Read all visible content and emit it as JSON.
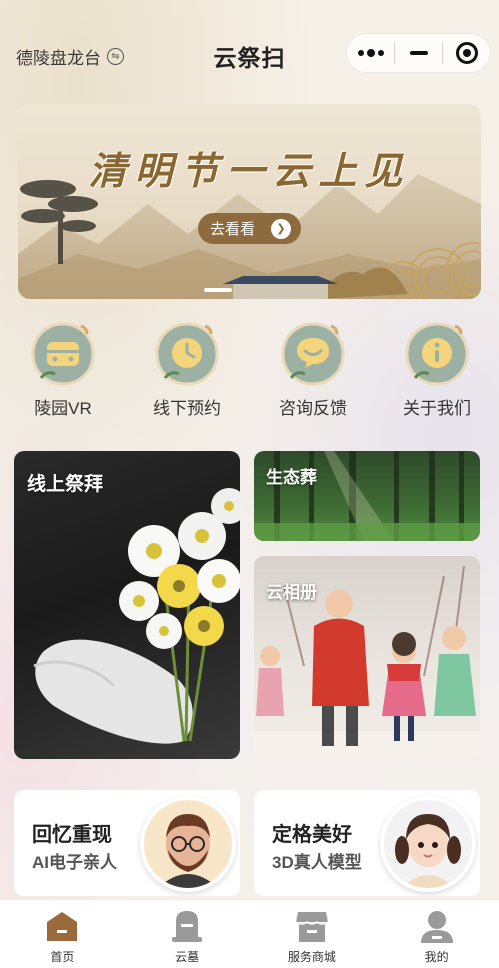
{
  "header": {
    "location": "德陵盘龙台",
    "title": "云祭扫"
  },
  "banner": {
    "title": "清明节一云上见",
    "button_label": "去看看"
  },
  "quick_menu": [
    {
      "label": "陵园VR",
      "icon": "vr-icon"
    },
    {
      "label": "线下预约",
      "icon": "clock-icon"
    },
    {
      "label": "咨询反馈",
      "icon": "chat-icon"
    },
    {
      "label": "关于我们",
      "icon": "info-icon"
    }
  ],
  "cards": {
    "online_worship": "线上祭拜",
    "eco_burial": "生态葬",
    "cloud_album": "云相册"
  },
  "promos": [
    {
      "title": "回忆重现",
      "subtitle": "AI电子亲人"
    },
    {
      "title": "定格美好",
      "subtitle": "3D真人模型"
    }
  ],
  "tabbar": [
    {
      "label": "首页",
      "icon": "home-icon",
      "active": true
    },
    {
      "label": "云墓",
      "icon": "tomb-icon",
      "active": false
    },
    {
      "label": "服务商城",
      "icon": "shop-icon",
      "active": false
    },
    {
      "label": "我的",
      "icon": "user-icon",
      "active": false
    }
  ],
  "colors": {
    "accent_brown": "#8e6a3f",
    "icon_teal": "#8fa89a",
    "icon_yellow": "#f4d57c",
    "tab_gray": "#9a9a9a"
  }
}
